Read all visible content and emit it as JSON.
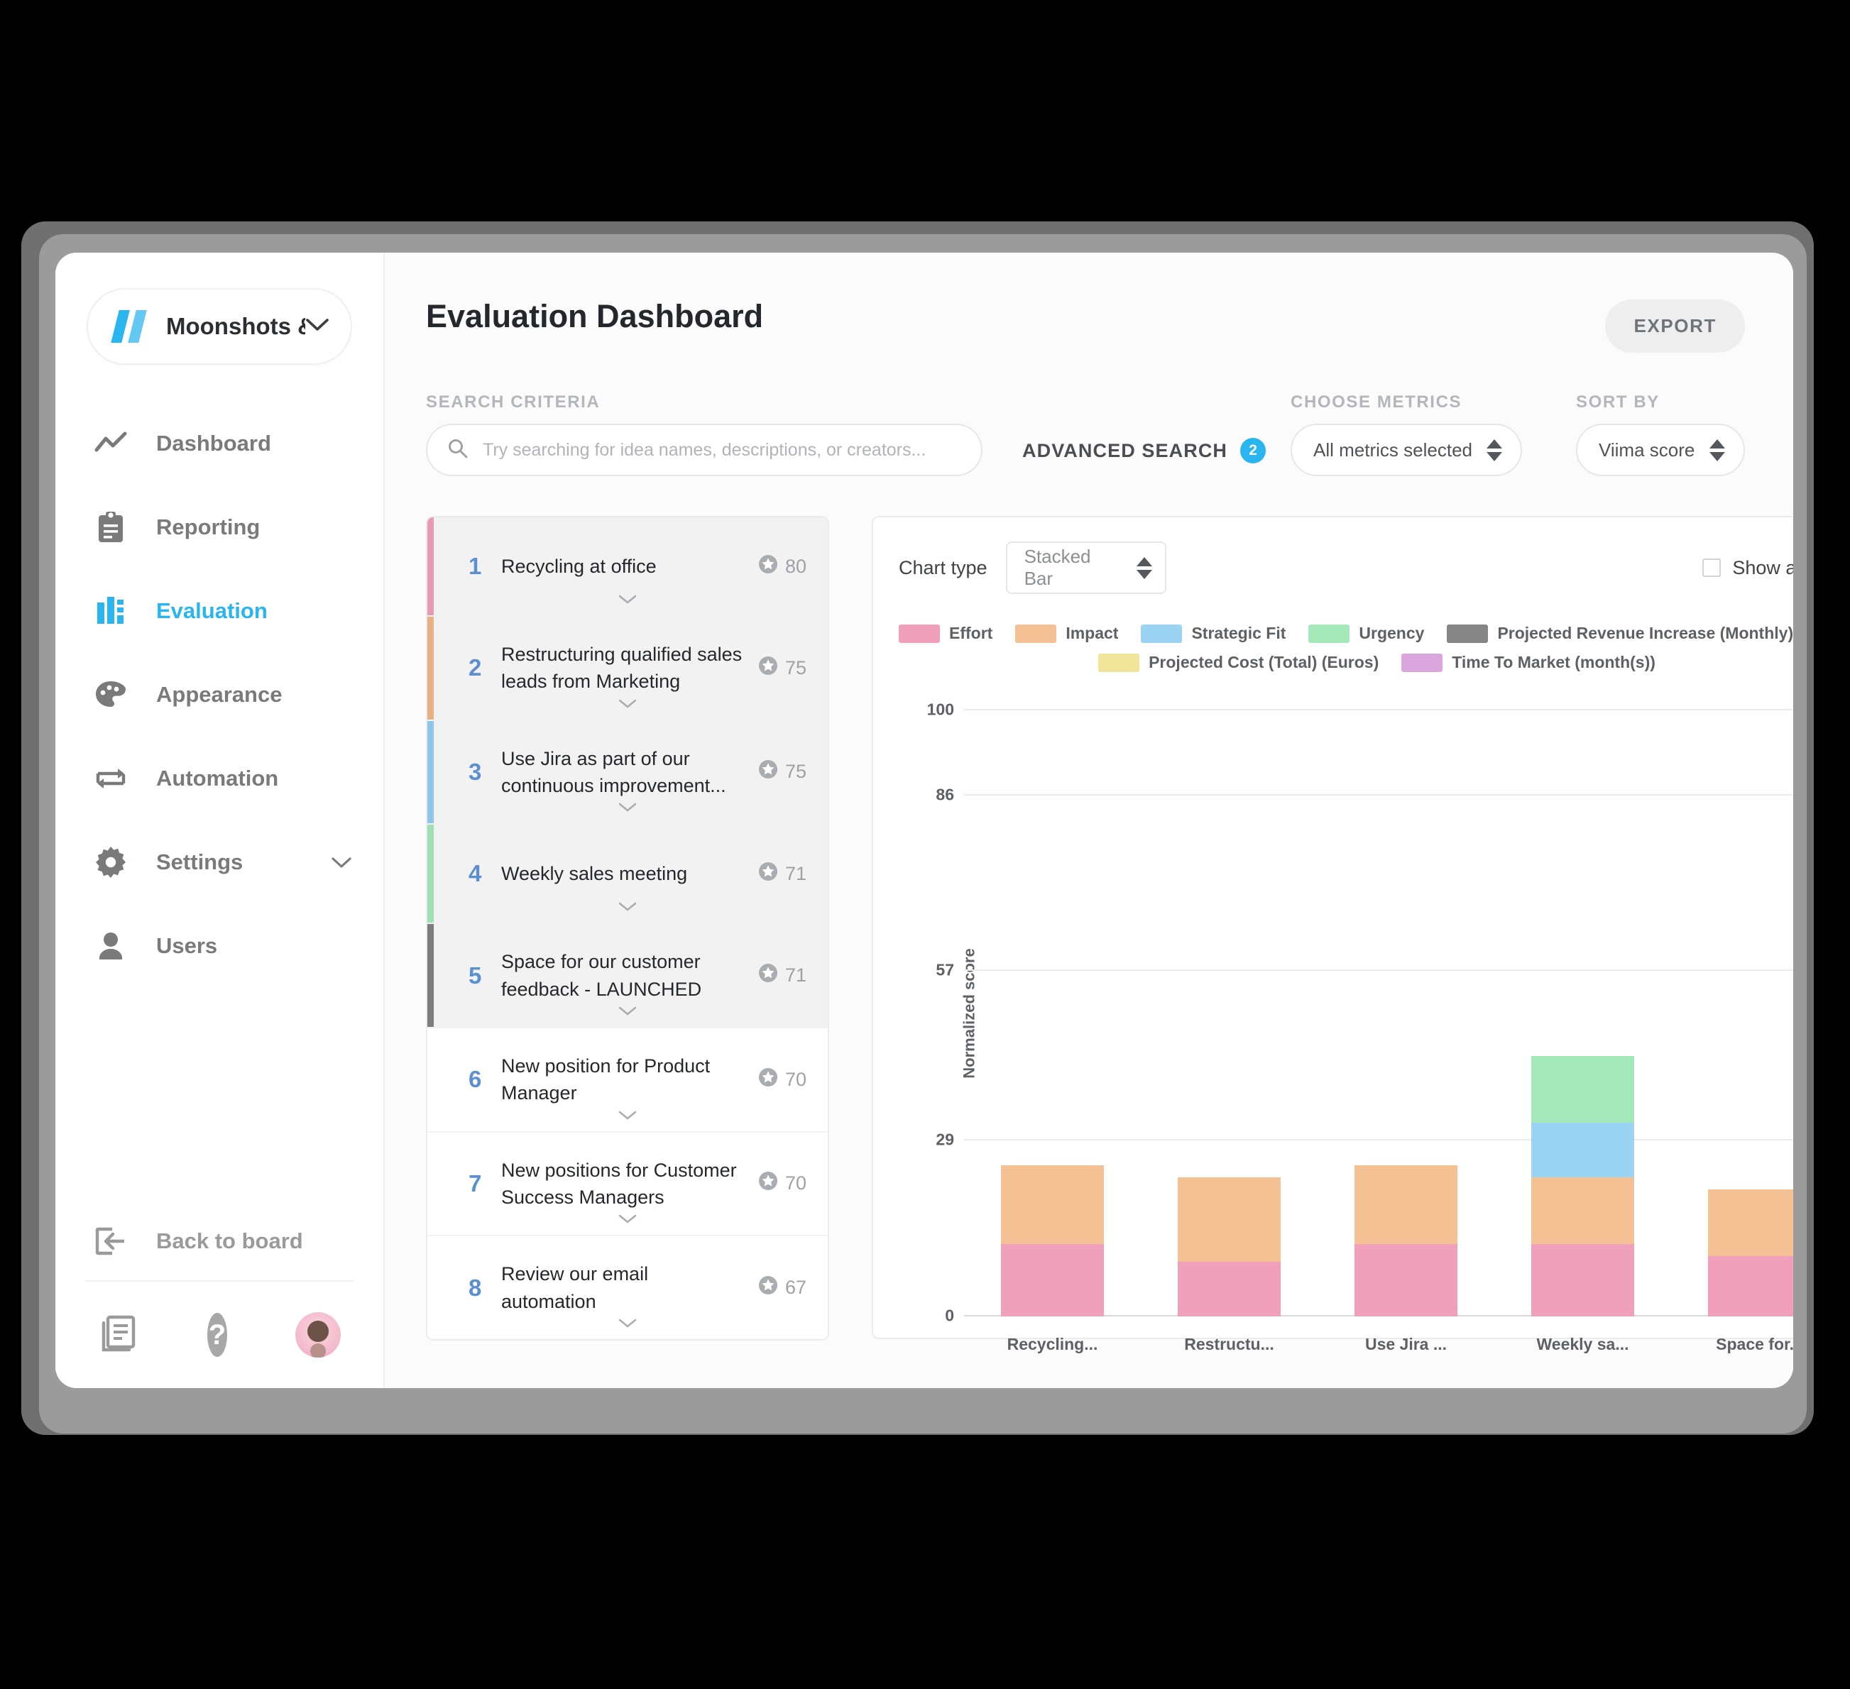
{
  "sidebar": {
    "board_name": "Moonshots &...",
    "nav_items": [
      {
        "label": "Dashboard",
        "icon": "trend-line-icon",
        "active": false,
        "has_chevron": false
      },
      {
        "label": "Reporting",
        "icon": "clipboard-icon",
        "active": false,
        "has_chevron": false
      },
      {
        "label": "Evaluation",
        "icon": "bar-chart-icon",
        "active": true,
        "has_chevron": false
      },
      {
        "label": "Appearance",
        "icon": "palette-icon",
        "active": false,
        "has_chevron": false
      },
      {
        "label": "Automation",
        "icon": "loop-arrows-icon",
        "active": false,
        "has_chevron": false
      },
      {
        "label": "Settings",
        "icon": "gear-icon",
        "active": false,
        "has_chevron": true
      },
      {
        "label": "Users",
        "icon": "person-icon",
        "active": false,
        "has_chevron": false
      }
    ],
    "back_to_board": "Back to board",
    "footer_icons": [
      "library-icon",
      "help-icon",
      "avatar"
    ]
  },
  "header": {
    "title": "Evaluation Dashboard",
    "export_label": "EXPORT"
  },
  "filters": {
    "search_label": "SEARCH CRITERIA",
    "search_placeholder": "Try searching for idea names, descriptions, or creators...",
    "search_value": "",
    "advanced_search_label": "ADVANCED SEARCH",
    "advanced_search_count": "2",
    "metrics_label": "CHOOSE METRICS",
    "metrics_value": "All metrics selected",
    "sort_label": "SORT BY",
    "sort_value": "Viima score"
  },
  "idea_list": [
    {
      "rank": "1",
      "title": "Recycling at office",
      "score": "80",
      "stripe": "#e899b3",
      "shaded": true
    },
    {
      "rank": "2",
      "title": "Restructuring qualified sales leads from Marketing",
      "score": "75",
      "stripe": "#e8b183",
      "shaded": true
    },
    {
      "rank": "3",
      "title": "Use Jira as part of our continuous improvement...",
      "score": "75",
      "stripe": "#8fc5e8",
      "shaded": true
    },
    {
      "rank": "4",
      "title": "Weekly sales meeting",
      "score": "71",
      "stripe": "#9fe0b4",
      "shaded": true
    },
    {
      "rank": "5",
      "title": "Space for our customer feedback - LAUNCHED",
      "score": "71",
      "stripe": "#7d7d7d",
      "shaded": true
    },
    {
      "rank": "6",
      "title": "New position for Product Manager",
      "score": "70",
      "stripe": "",
      "shaded": false
    },
    {
      "rank": "7",
      "title": "New positions for Customer Success Managers",
      "score": "70",
      "stripe": "",
      "shaded": false
    },
    {
      "rank": "8",
      "title": "Review our email automation",
      "score": "67",
      "stripe": "",
      "shaded": false
    }
  ],
  "chart_controls": {
    "chart_type_label": "Chart type",
    "chart_type_value": "Stacked Bar",
    "show_average_label": "Show average",
    "show_average_checked": false
  },
  "chart_data": {
    "type": "bar",
    "stacked": true,
    "title": "",
    "xlabel": "",
    "ylabel": "Normalized score",
    "ylim": [
      0,
      100
    ],
    "yticks": [
      0,
      29,
      57,
      86,
      100
    ],
    "grid": true,
    "legend_position": "top",
    "categories": [
      "Recycling...",
      "Restructu...",
      "Use Jira ...",
      "Weekly sa...",
      "Space for..."
    ],
    "series": [
      {
        "name": "Effort",
        "color": "#f0a0bb",
        "values": [
          12,
          9,
          12,
          12,
          10
        ]
      },
      {
        "name": "Impact",
        "color": "#f3c193",
        "values": [
          13,
          14,
          13,
          11,
          11
        ]
      },
      {
        "name": "Strategic Fit",
        "color": "#9bd4f2",
        "values": [
          0,
          0,
          0,
          9,
          0
        ]
      },
      {
        "name": "Urgency",
        "color": "#a5e8ba",
        "values": [
          0,
          0,
          0,
          11,
          0
        ]
      },
      {
        "name": "Projected Revenue Increase (Monthly) (Euros)",
        "color": "#858585",
        "values": [
          0,
          0,
          0,
          0,
          0
        ]
      },
      {
        "name": "Projected Cost (Total) (Euros)",
        "color": "#f0e39a",
        "values": [
          0,
          0,
          0,
          0,
          0
        ]
      },
      {
        "name": "Time To Market (month(s))",
        "color": "#dba6dd",
        "values": [
          0,
          0,
          0,
          0,
          0
        ]
      }
    ]
  }
}
